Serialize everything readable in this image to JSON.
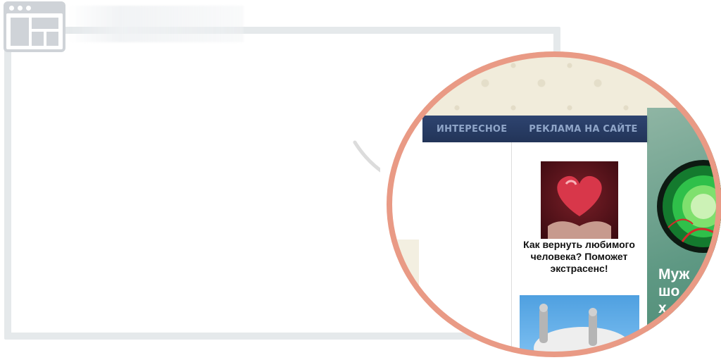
{
  "nav": {
    "items": [
      {
        "label": "ИНТЕРЕСНОЕ"
      },
      {
        "label": "РЕКЛАМА НА САЙТЕ"
      }
    ]
  },
  "ads": [
    {
      "text": "Как вернуть любимого человека? Поможет экстрасенс!",
      "image": "heart-in-hands"
    },
    {
      "text": "",
      "image": "power-plug"
    }
  ],
  "side_banner": {
    "text": "Муж\nшо\nх",
    "image": "green-gauge"
  },
  "colors": {
    "ring": "#e99a85",
    "nav_bg": "#2a3d64",
    "nav_text": "#8fa5c8",
    "frame": "#e5e9eb",
    "side_banner": "#6fa38f"
  }
}
